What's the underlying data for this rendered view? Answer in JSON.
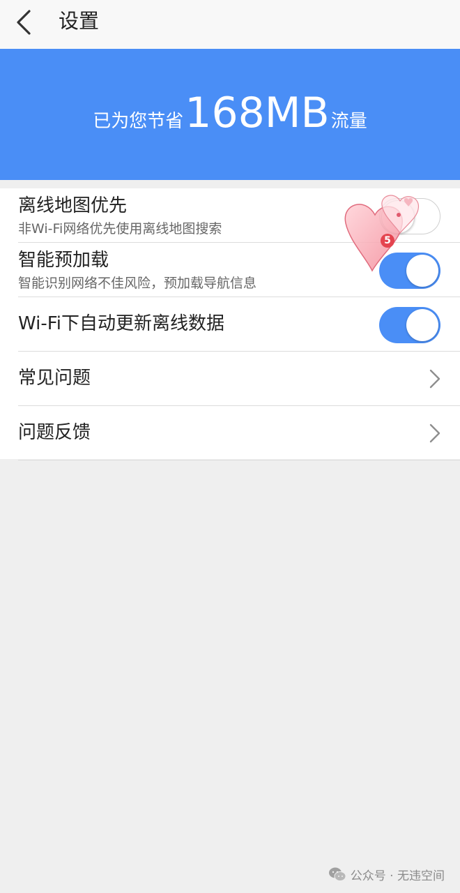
{
  "header": {
    "title": "设置",
    "back_icon": "chevron-left-icon"
  },
  "banner": {
    "prefix": "已为您节省",
    "amount": "168MB",
    "suffix": "流量",
    "background": "#4a8ef6"
  },
  "settings": {
    "offline_map_first": {
      "title": "离线地图优先",
      "subtitle": "非Wi-Fi网络优先使用离线地图搜索",
      "enabled": false
    },
    "smart_preload": {
      "title": "智能预加载",
      "subtitle": "智能识别网络不佳风险，预加载导航信息",
      "enabled": true
    },
    "wifi_auto_update": {
      "title": "Wi-Fi下自动更新离线数据",
      "enabled": true
    },
    "faq": {
      "title": "常见问题",
      "icon": "chevron-right-icon"
    },
    "feedback": {
      "title": "问题反馈",
      "icon": "chevron-right-icon"
    }
  },
  "sticker": {
    "icon": "heart-sticker-icon",
    "badge": "5"
  },
  "watermark": {
    "icon": "wechat-icon",
    "text": "公众号 · 无违空间"
  },
  "colors": {
    "accent": "#4a8ef6",
    "page_background": "#efefef",
    "divider": "#dcdcdc"
  }
}
